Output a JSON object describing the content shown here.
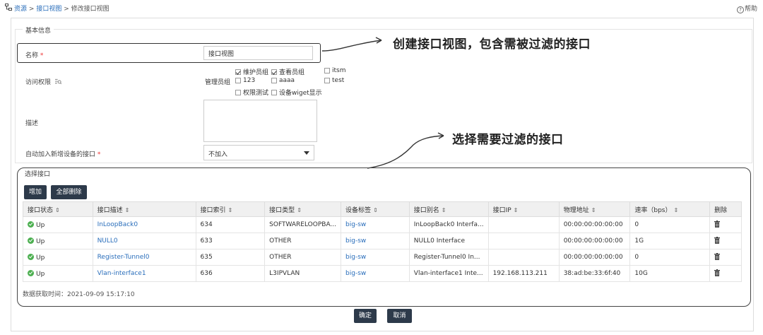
{
  "breadcrumb": {
    "home": "资源",
    "sep1": ">",
    "parent": "接口视图",
    "sep2": ">",
    "current": "修改接口视图"
  },
  "help": {
    "label": "帮助"
  },
  "basic_info": {
    "legend": "基本信息",
    "name_label": "名称",
    "required_mark": "*",
    "name_value": "接口视图",
    "access_label": "访问权限",
    "group_label": "管理员组",
    "groups": [
      {
        "label": "维护员组",
        "checked": true
      },
      {
        "label": "查看员组",
        "checked": true
      },
      {
        "label": "itsm",
        "checked": false
      },
      {
        "label": "123",
        "checked": false
      },
      {
        "label": "aaaa",
        "checked": false
      },
      {
        "label": "test",
        "checked": false
      },
      {
        "label": "权限测试",
        "checked": false
      },
      {
        "label": "设备wiget显示",
        "checked": false
      }
    ],
    "desc_label": "描述",
    "auto_add_label": "自动加入新增设备的接口",
    "auto_add_value": "不加入"
  },
  "annotations": {
    "callout1": "创建接口视图，包含需被过滤的接口",
    "callout2": "选择需要过滤的接口"
  },
  "select_section": {
    "legend": "选择接口",
    "add_button": "增加",
    "delete_all_button": "全部删除",
    "sort_glyph": "⇕",
    "columns": [
      "接口状态",
      "接口描述",
      "接口索引",
      "接口类型",
      "设备标签",
      "接口别名",
      "接口IP",
      "物理地址",
      "速率（bps）",
      "删除"
    ],
    "rows": [
      {
        "status": "Up",
        "desc": "InLoopBack0",
        "index": "634",
        "type": "SOFTWARELOOPBA...",
        "device": "big-sw",
        "alias": "InLoopBack0 Interfa...",
        "ip": "",
        "mac": "00:00:00:00:00:00",
        "rate": "0"
      },
      {
        "status": "Up",
        "desc": "NULL0",
        "index": "633",
        "type": "OTHER",
        "device": "big-sw",
        "alias": "NULL0 Interface",
        "ip": "",
        "mac": "00:00:00:00:00:00",
        "rate": "1G"
      },
      {
        "status": "Up",
        "desc": "Register-Tunnel0",
        "index": "635",
        "type": "OTHER",
        "device": "big-sw",
        "alias": "Register-Tunnel0 In...",
        "ip": "",
        "mac": "00:00:00:00:00:00",
        "rate": "0"
      },
      {
        "status": "Up",
        "desc": "Vlan-interface1",
        "index": "636",
        "type": "L3IPVLAN",
        "device": "big-sw",
        "alias": "Vlan-interface1 Inte...",
        "ip": "192.168.113.211",
        "mac": "38:ad:be:33:6f:40",
        "rate": "10G"
      }
    ],
    "fetch_time": "数据获取时间：2021-09-09 15:17:10"
  },
  "footer": {
    "ok_button": "确定",
    "cancel_button": "取消"
  },
  "colors": {
    "link": "#2a6ebb",
    "dark_button": "#2d3a4a",
    "status_up": "#4caf50",
    "required": "#e33333"
  }
}
